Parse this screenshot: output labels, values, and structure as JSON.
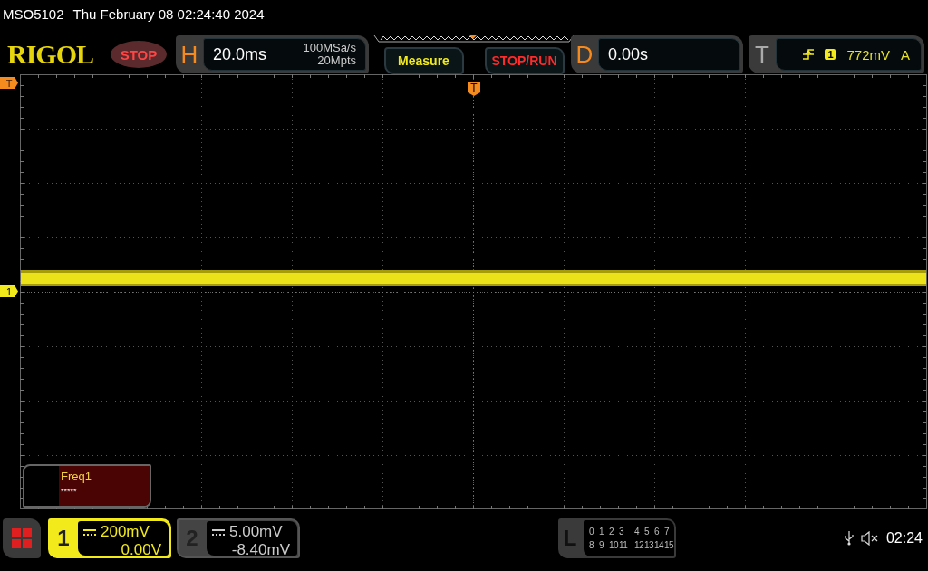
{
  "status_line": {
    "model": "MSO5102",
    "datetime": "Thu February 08 02:24:40 2024"
  },
  "toolbar": {
    "logo": "RIGOL",
    "run_state": "STOP",
    "horizontal": {
      "label": "H",
      "timebase": "20.0ms",
      "sample_rate": "100MSa/s",
      "memory_depth": "20Mpts"
    },
    "buttons": [
      {
        "label": "Measure",
        "kind": "measure"
      },
      {
        "label": "STOP/RUN",
        "kind": "run"
      }
    ],
    "delay": {
      "label": "D",
      "value": "0.00s"
    },
    "trigger": {
      "label": "T",
      "source": "1",
      "level": "772mV",
      "mode": "A"
    }
  },
  "graticule": {
    "trigger_level_marker": "T",
    "channel_marker": "1",
    "trigger_position_marker": "T"
  },
  "measurements": [
    {
      "name": "Freq1",
      "value": "*****"
    }
  ],
  "channels": [
    {
      "number": "1",
      "scale": "200mV",
      "offset": "0.00V",
      "selected": true
    },
    {
      "number": "2",
      "scale": "5.00mV",
      "offset": "-8.40mV",
      "selected": false
    }
  ],
  "logic": {
    "label": "L",
    "rows": [
      [
        "0",
        "1",
        "2",
        "3",
        "4",
        "5",
        "6",
        "7"
      ],
      [
        "8",
        "9",
        "10",
        "11",
        "12",
        "13",
        "14",
        "15"
      ]
    ]
  },
  "status_bar": {
    "muted": true,
    "time": "02:24"
  }
}
